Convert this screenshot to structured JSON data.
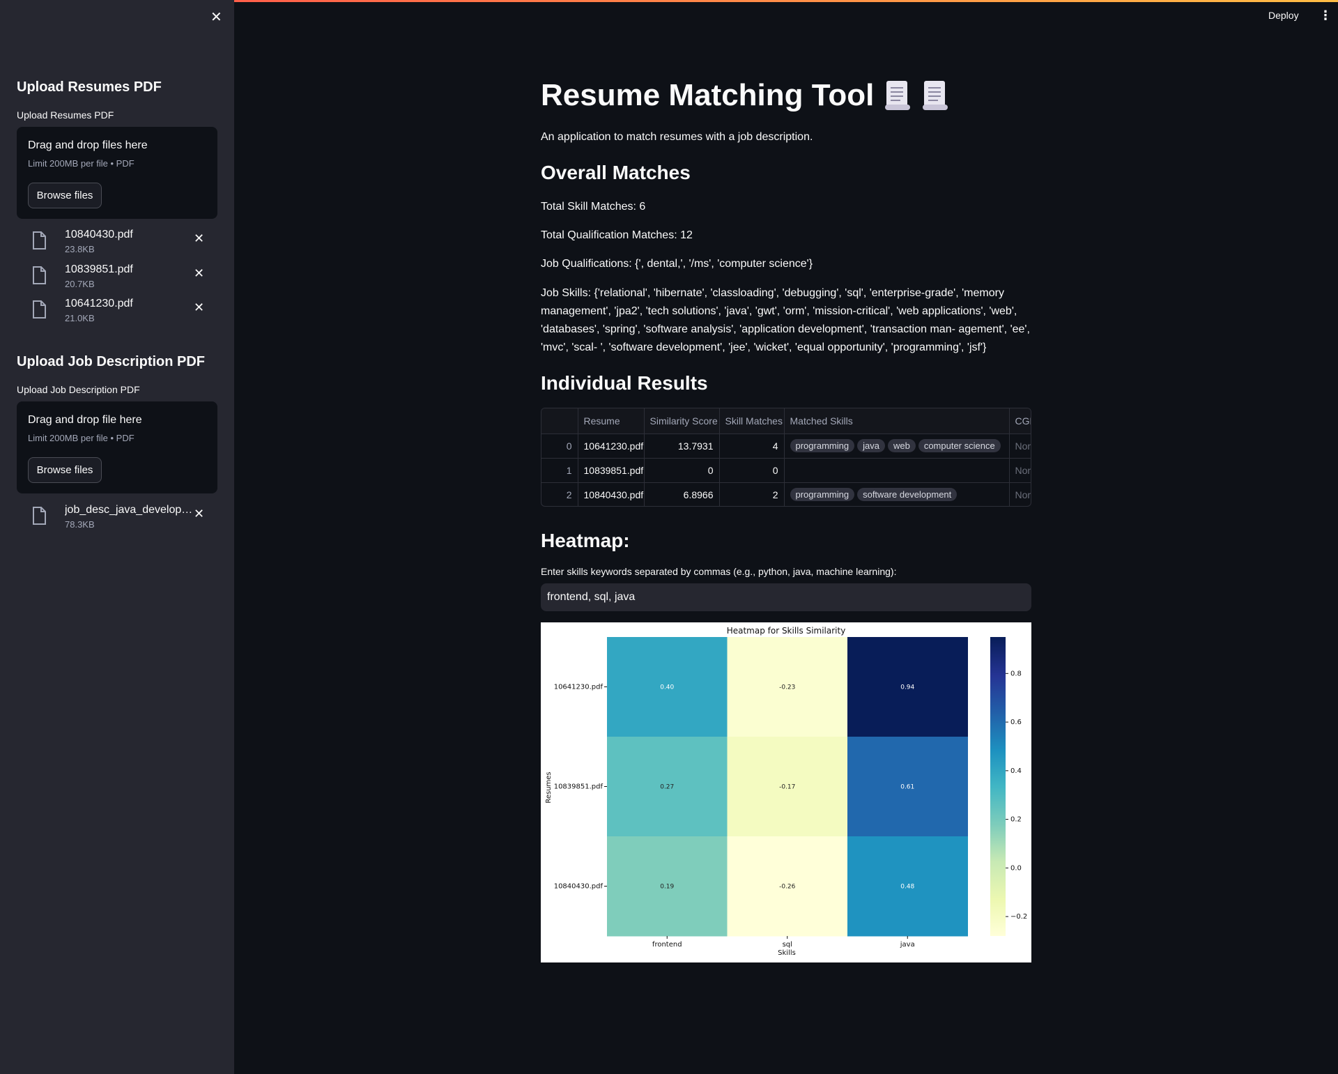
{
  "sidebar": {
    "resumes_heading": "Upload Resumes PDF",
    "resumes_label": "Upload Resumes PDF",
    "resumes_dropzone": {
      "title": "Drag and drop files here",
      "limit": "Limit 200MB per file • PDF",
      "button": "Browse files"
    },
    "resume_files": [
      {
        "name": "10840430.pdf",
        "size": "23.8KB"
      },
      {
        "name": "10839851.pdf",
        "size": "20.7KB"
      },
      {
        "name": "10641230.pdf",
        "size": "21.0KB"
      }
    ],
    "job_heading": "Upload Job Description PDF",
    "job_label": "Upload Job Description PDF",
    "job_dropzone": {
      "title": "Drag and drop file here",
      "limit": "Limit 200MB per file • PDF",
      "button": "Browse files"
    },
    "job_files": [
      {
        "name": "job_desc_java_developer.pdf",
        "size": "78.3KB"
      }
    ]
  },
  "header": {
    "deploy_label": "Deploy",
    "menu_icon": "vertical-dots-icon"
  },
  "main": {
    "title": "Resume Matching Tool",
    "title_icons": [
      "scroll-icon",
      "scroll-icon"
    ],
    "subtitle": "An application to match resumes with a job description.",
    "overall_heading": "Overall Matches",
    "total_skill_matches": "Total Skill Matches: 6",
    "total_qualification_matches": "Total Qualification Matches: 12",
    "job_qualifications": "Job Qualifications: {', dental,', '/ms', 'computer science'}",
    "job_skills": "Job Skills: {'relational', 'hibernate', 'classloading', 'debugging', 'sql', 'enterprise-grade', 'memory management', 'jpa2', 'tech solutions', 'java', 'gwt', 'orm', 'mission-critical', 'web applications', 'web', 'databases', 'spring', 'software analysis', 'application development', 'transaction man- agement', 'ee', 'mvc', 'scal- ', 'software development', 'jee', 'wicket', 'equal opportunity', 'programming', 'jsf'}",
    "individual_heading": "Individual Results",
    "table": {
      "columns": [
        "",
        "Resume",
        "Similarity Score",
        "Skill Matches",
        "Matched Skills",
        "CGPA"
      ],
      "rows": [
        {
          "index": "0",
          "resume": "10641230.pdf",
          "score": "13.7931",
          "skill_matches": "4",
          "matched_skills": [
            "programming",
            "java",
            "web",
            "computer science"
          ],
          "cgpa": "None"
        },
        {
          "index": "1",
          "resume": "10839851.pdf",
          "score": "0",
          "skill_matches": "0",
          "matched_skills": [],
          "cgpa": "None"
        },
        {
          "index": "2",
          "resume": "10840430.pdf",
          "score": "6.8966",
          "skill_matches": "2",
          "matched_skills": [
            "programming",
            "software development"
          ],
          "cgpa": "None"
        }
      ]
    },
    "heatmap_heading": "Heatmap:",
    "skills_input_label": "Enter skills keywords separated by commas (e.g., python, java, machine learning):",
    "skills_input_value": "frontend, sql, java"
  },
  "chart_data": {
    "type": "heatmap",
    "title": "Heatmap for Skills Similarity",
    "xlabel": "Skills",
    "ylabel": "Resumes",
    "x": [
      "frontend",
      "sql",
      "java"
    ],
    "y": [
      "10641230.pdf",
      "10839851.pdf",
      "10840430.pdf"
    ],
    "values": [
      [
        0.4,
        -0.23,
        0.94
      ],
      [
        0.27,
        -0.17,
        0.61
      ],
      [
        0.19,
        -0.26,
        0.48
      ]
    ],
    "value_labels": [
      [
        "0.40",
        "-0.23",
        "0.94"
      ],
      [
        "0.27",
        "-0.17",
        "0.61"
      ],
      [
        "0.19",
        "-0.26",
        "0.48"
      ]
    ],
    "colormap": "YlGnBu",
    "vmin": -0.26,
    "vmax": 0.94,
    "colorbar_ticks": [
      0.8,
      0.6,
      0.4,
      0.2,
      0.0,
      -0.2
    ],
    "colorbar_tick_labels": [
      "0.8",
      "0.6",
      "0.4",
      "0.2",
      "0.0",
      "−0.2"
    ]
  }
}
